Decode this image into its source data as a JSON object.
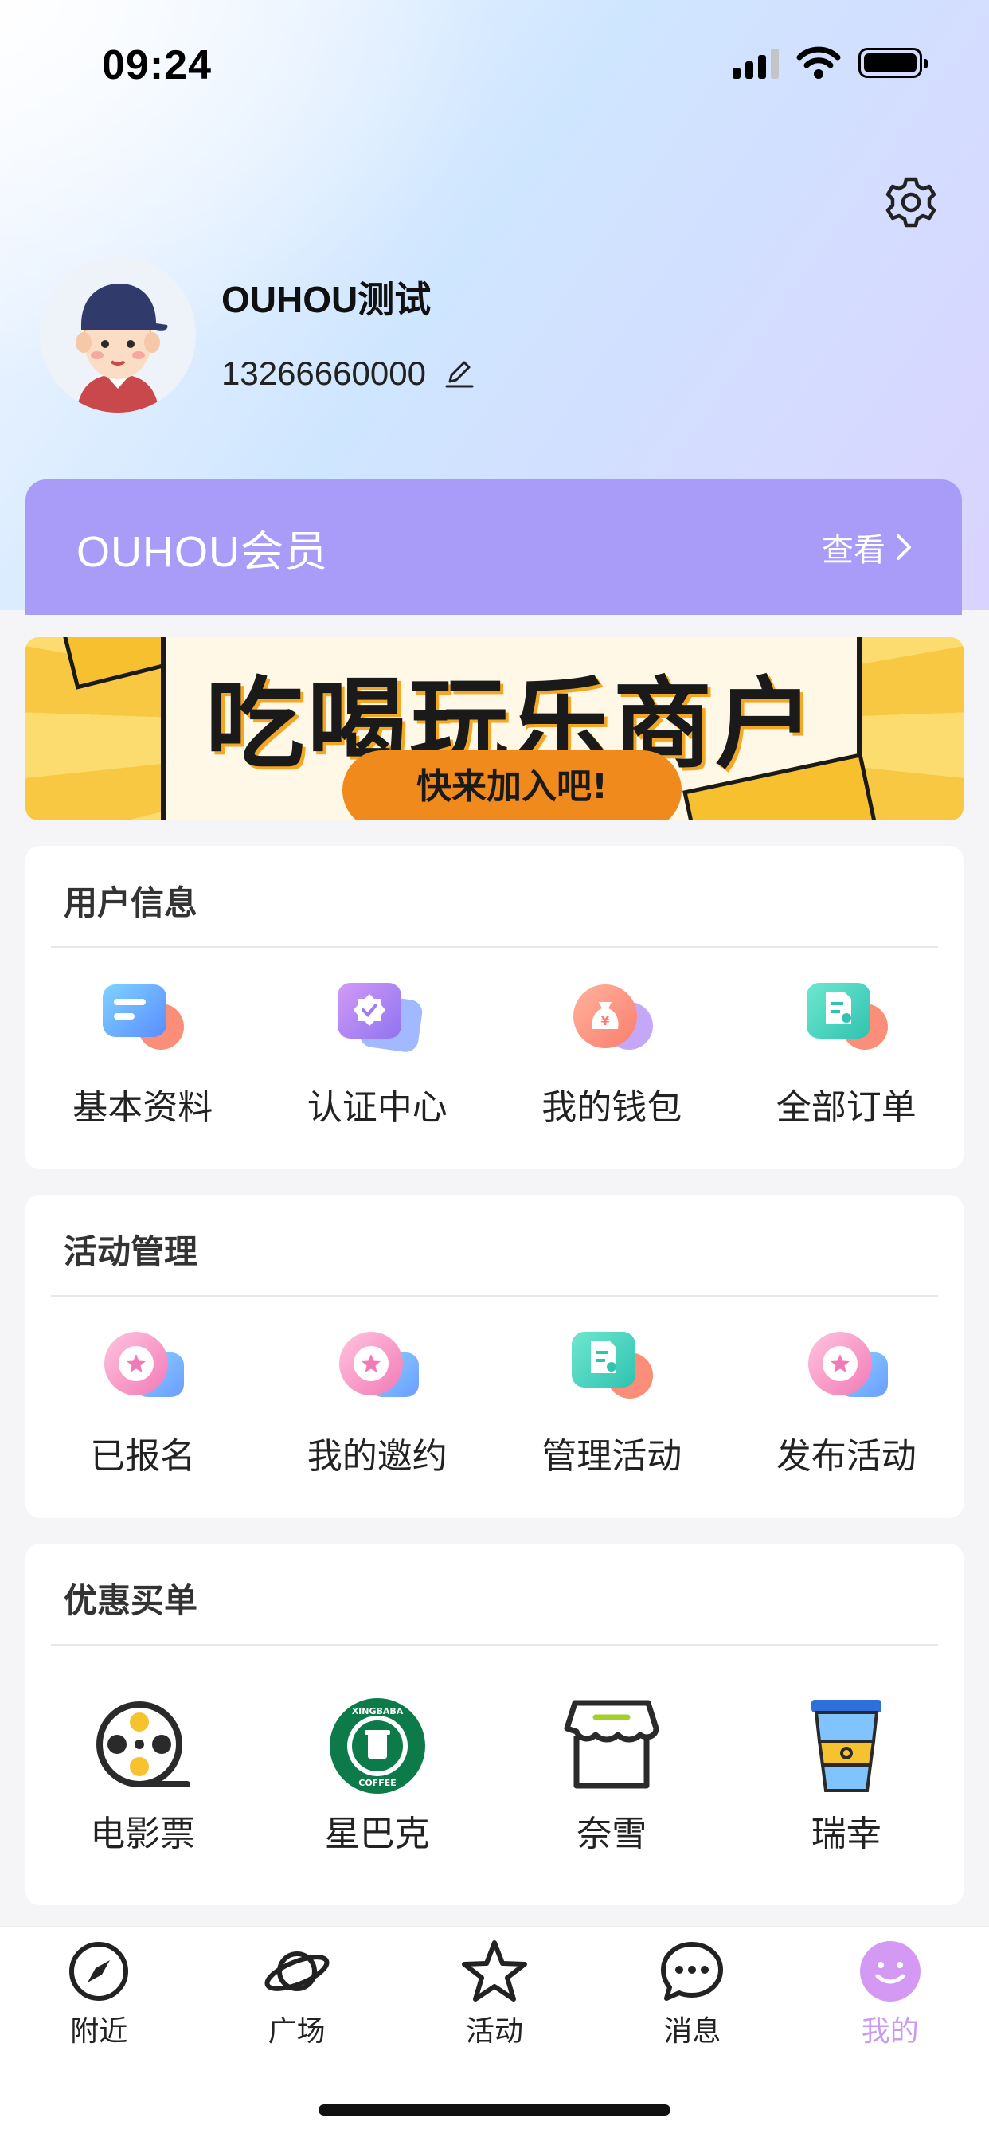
{
  "status_bar": {
    "time": "09:24"
  },
  "profile": {
    "name": "OUHOU测试",
    "phone": "13266660000"
  },
  "member": {
    "title": "OUHOU会员",
    "view_label": "查看"
  },
  "banner": {
    "title": "吃喝玩乐商户",
    "cta": "快来加入吧!"
  },
  "sections": {
    "user_info": {
      "title": "用户信息",
      "items": [
        {
          "label": "基本资料",
          "icon": "profile-card-icon"
        },
        {
          "label": "认证中心",
          "icon": "verified-badge-icon"
        },
        {
          "label": "我的钱包",
          "icon": "money-bag-icon"
        },
        {
          "label": "全部订单",
          "icon": "order-document-icon"
        }
      ]
    },
    "activity": {
      "title": "活动管理",
      "items": [
        {
          "label": "已报名",
          "icon": "star-badge-icon"
        },
        {
          "label": "我的邀约",
          "icon": "star-badge-icon"
        },
        {
          "label": "管理活动",
          "icon": "order-document-icon"
        },
        {
          "label": "发布活动",
          "icon": "star-badge-icon"
        }
      ]
    },
    "discount": {
      "title": "优惠买单",
      "items": [
        {
          "label": "电影票",
          "icon": "film-reel-icon"
        },
        {
          "label": "星巴克",
          "icon": "starbucks-logo-icon",
          "logo_text": "XINGBABA COFFEE"
        },
        {
          "label": "奈雪",
          "icon": "shop-icon"
        },
        {
          "label": "瑞幸",
          "icon": "coffee-cup-icon"
        }
      ]
    }
  },
  "tabbar": {
    "items": [
      {
        "label": "附近",
        "icon": "compass-icon"
      },
      {
        "label": "广场",
        "icon": "planet-icon"
      },
      {
        "label": "活动",
        "icon": "star-icon"
      },
      {
        "label": "消息",
        "icon": "chat-bubble-icon"
      },
      {
        "label": "我的",
        "icon": "smiley-icon",
        "active": true
      }
    ]
  },
  "colors": {
    "member_card": "#a99cf8",
    "active_tab": "#c79cf2",
    "background": "#f5f5f7"
  }
}
